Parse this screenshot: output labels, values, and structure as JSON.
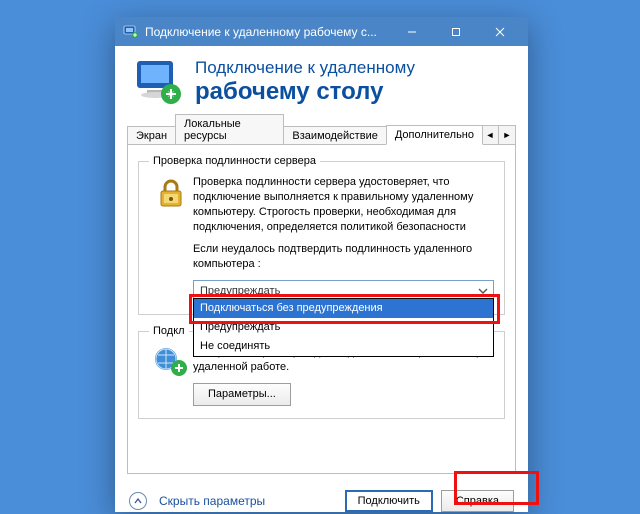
{
  "window": {
    "title": "Подключение к удаленному рабочему с..."
  },
  "header": {
    "line1": "Подключение к удаленному",
    "line2": "рабочему столу"
  },
  "tabs": {
    "items": [
      "Экран",
      "Локальные ресурсы",
      "Взаимодействие",
      "Дополнительно"
    ],
    "active_index": 3
  },
  "group_auth": {
    "legend": "Проверка подлинности сервера",
    "text1": "Проверка подлинности сервера удостоверяет, что подключение выполняется к правильному удаленному компьютеру. Строгость проверки, необходимая для подключения, определяется политикой безопасности",
    "text2": "Если неудалось подтвердить подлинность удаленного компьютера :",
    "combo_value": "Предупреждать",
    "options": [
      "Подключаться без предупреждения",
      "Предупреждать",
      "Не соединять"
    ],
    "highlight_index": 0
  },
  "group_gateway": {
    "legend": "Подкл",
    "text": "Настройка параметров для подключения через шлюз при удаленной работе.",
    "button": "Параметры..."
  },
  "footer": {
    "collapse": "Скрыть параметры",
    "connect": "Подключить",
    "help": "Справка"
  }
}
